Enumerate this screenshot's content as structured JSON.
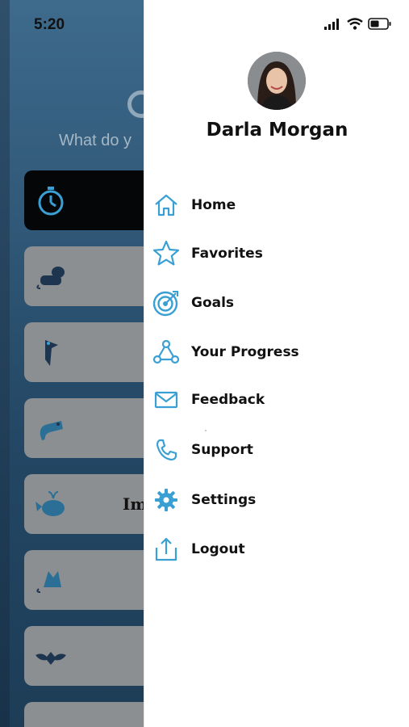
{
  "status_bar": {
    "time": "5:20"
  },
  "background_screen": {
    "prompt_partial": "What do y",
    "partial_title": "Im"
  },
  "drawer": {
    "user_name": "Darla Morgan",
    "menu": [
      {
        "label": "Home",
        "icon": "home-icon"
      },
      {
        "label": "Favorites",
        "icon": "star-icon"
      },
      {
        "label": "Goals",
        "icon": "target-icon"
      },
      {
        "label": "Your Progress",
        "icon": "progress-icon"
      },
      {
        "label": "Feedback",
        "icon": "mail-icon"
      },
      {
        "label": "Support",
        "icon": "phone-icon"
      },
      {
        "label": "Settings",
        "icon": "gear-icon"
      },
      {
        "label": "Logout",
        "icon": "logout-icon"
      }
    ]
  },
  "colors": {
    "accent": "#3aa0d4",
    "overlay": "#1d3d57"
  }
}
